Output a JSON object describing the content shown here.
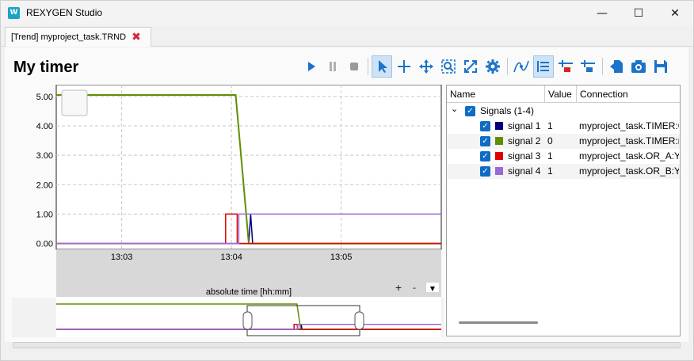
{
  "window": {
    "title": "REXYGEN Studio"
  },
  "tab": {
    "label": "[Trend] myproject_task.TRND"
  },
  "page": {
    "heading": "My timer"
  },
  "toolbar": {
    "buttons": [
      "play",
      "pause",
      "stop",
      "select",
      "crosshair",
      "pan",
      "zoom-region",
      "zoom-fit",
      "settings",
      "curve",
      "signal-list",
      "remove-signal",
      "add-signal",
      "export",
      "screenshot",
      "save"
    ]
  },
  "plot": {
    "y_ticks": [
      "5.00",
      "4.00",
      "3.00",
      "2.00",
      "1.00",
      "0.00"
    ],
    "x_ticks": [
      "13:03",
      "13:04",
      "13:05"
    ],
    "xlabel": "absolute time [hh:mm]",
    "zoom_in": "+",
    "zoom_out": "-",
    "menu_arrow": "▼"
  },
  "chart_data": {
    "type": "line",
    "xlabel": "absolute time [hh:mm]",
    "ylabel": "",
    "ylim": [
      -0.2,
      5.4
    ],
    "x_ticks": [
      "13:03",
      "13:04",
      "13:05"
    ],
    "grid": true,
    "series": [
      {
        "name": "signal 1",
        "color": "#00007f",
        "points": [
          [
            0,
            0
          ],
          [
            0.5,
            0
          ],
          [
            0.505,
            1
          ],
          [
            0.51,
            0
          ],
          [
            1,
            0
          ]
        ]
      },
      {
        "name": "signal 2",
        "color": "#5f8f00",
        "points": [
          [
            0,
            5.05
          ],
          [
            0.466,
            5.05
          ],
          [
            0.5,
            0
          ],
          [
            1,
            0
          ]
        ]
      },
      {
        "name": "signal 3",
        "color": "#e00000",
        "points": [
          [
            0,
            0
          ],
          [
            0.44,
            0
          ],
          [
            0.44,
            1
          ],
          [
            0.47,
            1
          ],
          [
            0.47,
            0
          ],
          [
            1,
            0
          ]
        ]
      },
      {
        "name": "signal 4",
        "color": "#9a6ad4",
        "points": [
          [
            0,
            0
          ],
          [
            0.474,
            0
          ],
          [
            0.474,
            1
          ],
          [
            1,
            1
          ]
        ]
      }
    ]
  },
  "tree": {
    "columns": [
      "Name",
      "Value",
      "Connection"
    ],
    "group": {
      "label": "Signals (1-4)",
      "expand_glyph": "⌄"
    },
    "rows": [
      {
        "name": "signal 1",
        "value": "1",
        "connection": "myproject_task.TIMER:Q",
        "color": "#00007f"
      },
      {
        "name": "signal 2",
        "value": "0",
        "connection": "myproject_task.TIMER:rt",
        "color": "#5f8f00"
      },
      {
        "name": "signal 3",
        "value": "1",
        "connection": "myproject_task.OR_A:Y",
        "color": "#e00000"
      },
      {
        "name": "signal 4",
        "value": "1",
        "connection": "myproject_task.OR_B:Y",
        "color": "#9a6ad4"
      }
    ]
  },
  "glyphs": {
    "check": "✓",
    "close_tab": "✖",
    "minimize": "—",
    "maximize": "☐",
    "close_window": "✕"
  }
}
